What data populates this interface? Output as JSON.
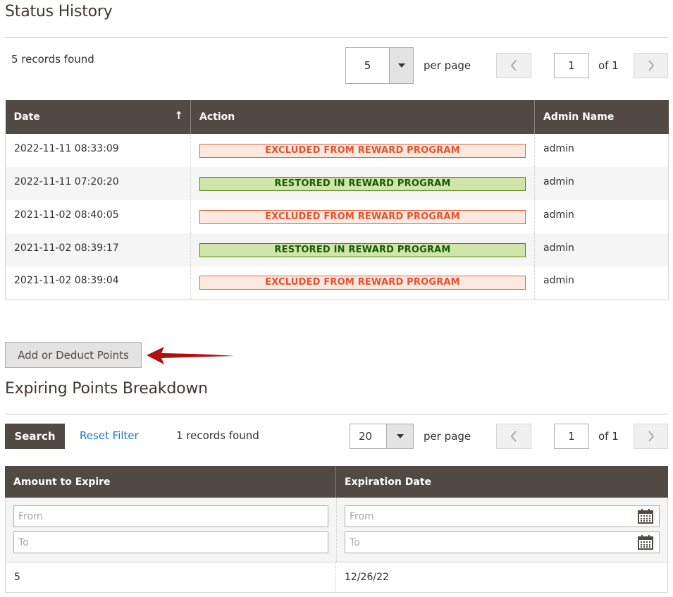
{
  "status_history": {
    "title": "Status History",
    "records_found": "5 records found",
    "per_page_value": "5",
    "per_page_label": "per page",
    "prev_icon": "chevron-left-icon",
    "next_icon": "chevron-right-icon",
    "page_value": "1",
    "of_label": "of 1",
    "columns": [
      "Date",
      "Action",
      "Admin Name"
    ],
    "sort_icon": "sort-up-arrow-icon",
    "rows": [
      {
        "date": "2022-11-11 08:33:09",
        "action": "EXCLUDED FROM REWARD PROGRAM",
        "type": "excluded",
        "admin": "admin"
      },
      {
        "date": "2022-11-11 07:20:20",
        "action": "RESTORED IN REWARD PROGRAM",
        "type": "restored",
        "admin": "admin"
      },
      {
        "date": "2021-11-02 08:40:05",
        "action": "EXCLUDED FROM REWARD PROGRAM",
        "type": "excluded",
        "admin": "admin"
      },
      {
        "date": "2021-11-02 08:39:17",
        "action": "RESTORED IN REWARD PROGRAM",
        "type": "restored",
        "admin": "admin"
      },
      {
        "date": "2021-11-02 08:39:04",
        "action": "EXCLUDED FROM REWARD PROGRAM",
        "type": "excluded",
        "admin": "admin"
      }
    ]
  },
  "add_deduct_button": "Add or Deduct Points",
  "annotation_arrow_color": "#b00f0f",
  "expiring": {
    "title": "Expiring Points Breakdown",
    "search_label": "Search",
    "reset_filter_label": "Reset Filter",
    "records_found": "1 records found",
    "per_page_value": "20",
    "per_page_label": "per page",
    "page_value": "1",
    "of_label": "of 1",
    "columns": [
      "Amount to Expire",
      "Expiration Date"
    ],
    "filters": {
      "amount_from_placeholder": "From",
      "amount_to_placeholder": "To",
      "date_from_placeholder": "From",
      "date_to_placeholder": "To",
      "calendar_icon": "calendar-icon"
    },
    "rows": [
      {
        "amount": "5",
        "expiration_date": "12/26/22"
      }
    ]
  },
  "colors": {
    "header_bg": "#514943",
    "excluded_text": "#e1522e",
    "excluded_bg": "#fde9e0",
    "restored_text": "#185b00",
    "restored_bg": "#d0e5a9",
    "link": "#1979c3"
  }
}
